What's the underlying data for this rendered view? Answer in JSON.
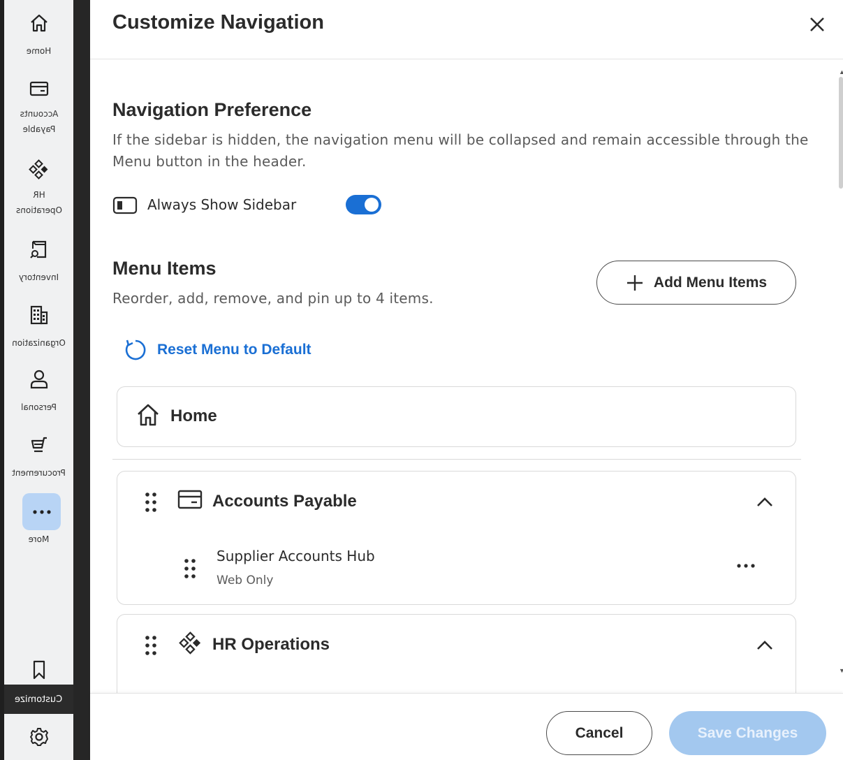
{
  "sidebar": {
    "items": [
      {
        "label": "Home",
        "icon": "home-icon"
      },
      {
        "label": "Accounts Payable",
        "icon": "card-icon"
      },
      {
        "label": "HR Operations",
        "icon": "diamond-grid-icon"
      },
      {
        "label": "Inventory",
        "icon": "box-search-icon"
      },
      {
        "label": "Organization",
        "icon": "building-icon"
      },
      {
        "label": "Personal",
        "icon": "person-icon"
      },
      {
        "label": "Procurement",
        "icon": "cart-icon"
      }
    ],
    "more_label": "More",
    "customize_tooltip": "Customize",
    "bookmark_icon": "bookmark-icon",
    "settings_icon": "gear-icon"
  },
  "dialog": {
    "title": "Customize Navigation",
    "preference": {
      "heading": "Navigation Preference",
      "description": "If the sidebar is hidden, the navigation menu will be collapsed and remain accessible through the Menu button in the header.",
      "toggle_label": "Always Show Sidebar",
      "toggle_on": true
    },
    "menu_items": {
      "heading": "Menu Items",
      "description": "Reorder, add, remove, and pin up to 4 items.",
      "add_button": "Add Menu Items",
      "reset_label": "Reset Menu to Default",
      "home_card": "Home",
      "groups": [
        {
          "title": "Accounts Payable",
          "children": [
            {
              "title": "Supplier Accounts Hub",
              "meta": "Web Only"
            }
          ]
        },
        {
          "title": "HR Operations",
          "children": []
        }
      ]
    },
    "footer": {
      "cancel": "Cancel",
      "save": "Save Changes"
    }
  },
  "colors": {
    "accent": "#1a6fd4",
    "save_disabled": "#a3c8ef",
    "more_highlight": "#b8d4f5"
  }
}
